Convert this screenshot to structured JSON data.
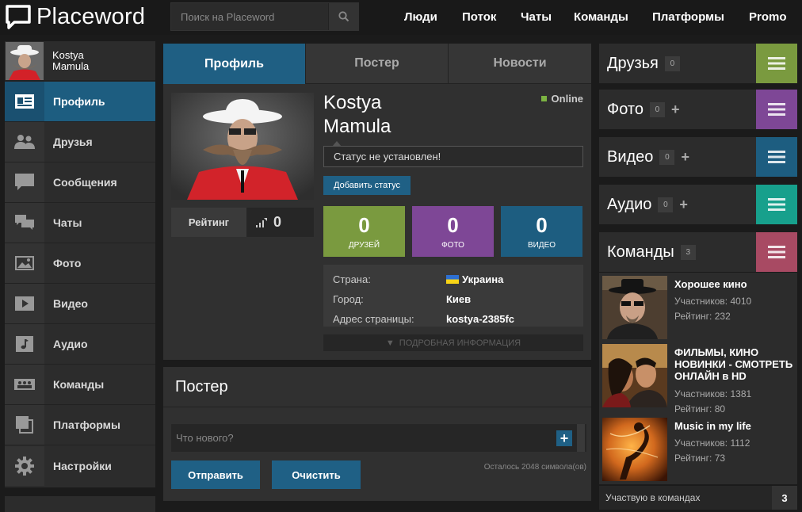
{
  "app": {
    "logo_text": "Placeword"
  },
  "search": {
    "placeholder": "Поиск на Placeword"
  },
  "topnav": [
    "Люди",
    "Поток",
    "Чаты",
    "Команды",
    "Платформы",
    "Promo"
  ],
  "user": {
    "first_name": "Kostya",
    "last_name": "Mamula"
  },
  "sidebar": {
    "items": [
      {
        "label": "Профиль",
        "icon": "profile-card-icon",
        "active": true
      },
      {
        "label": "Друзья",
        "icon": "friends-icon"
      },
      {
        "label": "Сообщения",
        "icon": "message-icon"
      },
      {
        "label": "Чаты",
        "icon": "chats-icon"
      },
      {
        "label": "Фото",
        "icon": "photo-icon"
      },
      {
        "label": "Видео",
        "icon": "video-icon"
      },
      {
        "label": "Аудио",
        "icon": "music-note-icon"
      },
      {
        "label": "Команды",
        "icon": "teams-icon"
      },
      {
        "label": "Платформы",
        "icon": "platforms-icon"
      },
      {
        "label": "Настройки",
        "icon": "gear-icon"
      }
    ]
  },
  "tabs": [
    "Профиль",
    "Постер",
    "Новости"
  ],
  "profile": {
    "first_name": "Kostya",
    "last_name": "Mamula",
    "online_label": "Online",
    "status_text": "Статус не установлен!",
    "add_status_label": "Добавить статус",
    "rating_label": "Рейтинг",
    "rating_value": "0",
    "stats": [
      {
        "value": "0",
        "caption": "ДРУЗЕЙ",
        "color": "#7a9a3f"
      },
      {
        "value": "0",
        "caption": "ФОТО",
        "color": "#7e4796"
      },
      {
        "value": "0",
        "caption": "ВИДЕО",
        "color": "#1d5d80"
      }
    ],
    "info": [
      {
        "key": "Страна:",
        "value": "Украина"
      },
      {
        "key": "Город:",
        "value": "Киев"
      },
      {
        "key": "Адрес страницы:",
        "value": "kostya-2385fc"
      }
    ],
    "more_info_label": "ПОДРОБНАЯ ИНФОРМАЦИЯ"
  },
  "poster": {
    "title": "Постер",
    "placeholder": "Что нового?",
    "send_label": "Отправить",
    "clear_label": "Очистить",
    "remaining_text": "Осталось 2048 символа(ов)"
  },
  "right": {
    "blocks": [
      {
        "title": "Друзья",
        "count": "0",
        "plus": false,
        "color": "#7a9a3f"
      },
      {
        "title": "Фото",
        "count": "0",
        "plus": true,
        "color": "#7e4796"
      },
      {
        "title": "Видео",
        "count": "0",
        "plus": true,
        "color": "#1d5d80"
      },
      {
        "title": "Аудио",
        "count": "0",
        "plus": true,
        "color": "#17a08c"
      },
      {
        "title": "Команды",
        "count": "3",
        "plus": false,
        "color": "#a84a63"
      }
    ],
    "teams": [
      {
        "name": "Хорошее кино",
        "members": "Участников: 4010",
        "rating": "Рейтинг: 232"
      },
      {
        "name": "ФИЛЬМЫ, КИНО НОВИНКИ - СМОТРЕТЬ ОНЛАЙН в HD",
        "members": "Участников: 1381",
        "rating": "Рейтинг: 80"
      },
      {
        "name": "Music in my life",
        "members": "Участников: 1112",
        "rating": "Рейтинг: 73"
      }
    ],
    "teams_footer_label": "Участвую в командах",
    "teams_footer_count": "3"
  }
}
